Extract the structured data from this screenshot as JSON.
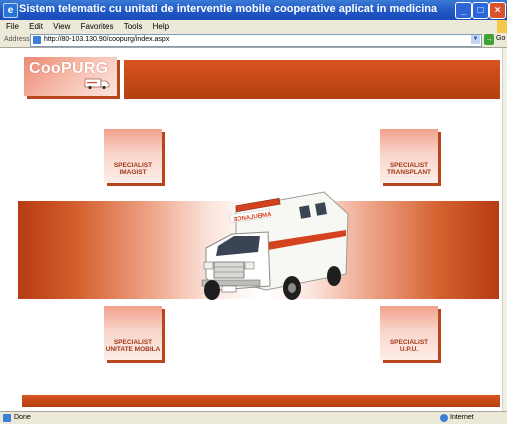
{
  "window": {
    "title": "Sistem telematic cu unitati de interventie mobile cooperative aplicat in medicina de urgenta şi - Microsoft Internet Explorer",
    "controls": {
      "minimize": "_",
      "maximize": "□",
      "close": "×"
    }
  },
  "menubar": {
    "items": [
      "File",
      "Edit",
      "View",
      "Favorites",
      "Tools",
      "Help"
    ]
  },
  "addressbar": {
    "label": "Address",
    "url": "http://80-103.130.90/coopurg/index.aspx",
    "go_label": "Go"
  },
  "page": {
    "logo": "CooPURG",
    "tiles": {
      "imagist": {
        "line1": "SPECIALIST",
        "line2": "IMAGIST"
      },
      "transplant": {
        "line1": "SPECIALIST",
        "line2": "TRANSPLANT"
      },
      "mobila": {
        "line1": "SPECIALIST",
        "line2": "UNITATE MOBILA"
      },
      "upu": {
        "line1": "SPECIALIST",
        "line2": "U.P.U."
      }
    },
    "colors": {
      "accent": "#c44a18",
      "tile_light": "#f9d4c9"
    }
  },
  "statusbar": {
    "status": "Done",
    "zone": "Internet"
  }
}
